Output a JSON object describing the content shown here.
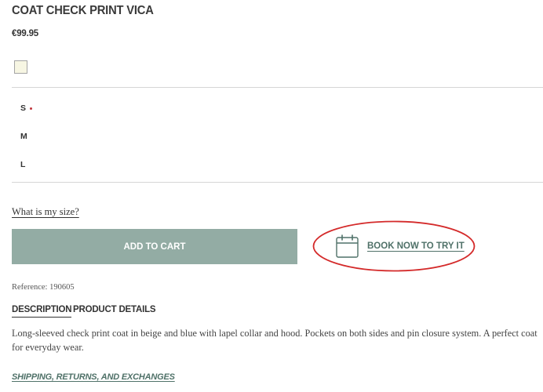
{
  "product": {
    "title": "COAT CHECK PRINT VICA",
    "price": "€99.95",
    "reference": "Reference: 190605"
  },
  "colors": {
    "swatch": "#f7f6e3",
    "accent": "#93aca4",
    "link": "#4f7168",
    "highlight": "#d42a2a",
    "selected_dot": "#c0343c"
  },
  "sizes": [
    {
      "label": "S",
      "selected": true
    },
    {
      "label": "M",
      "selected": false
    },
    {
      "label": "L",
      "selected": false
    }
  ],
  "size_guide_link": "What is my size?",
  "actions": {
    "add_to_cart": "ADD TO CART",
    "book_try": "BOOK NOW TO TRY IT",
    "book_icon": "calendar-icon"
  },
  "tabs": [
    {
      "label": "DESCRIPTION",
      "active": true
    },
    {
      "label": "PRODUCT DETAILS",
      "active": false
    }
  ],
  "description": "Long-sleeved check print coat in beige and blue with lapel collar and hood. Pockets on both sides and pin closure system. A perfect coat for everyday wear.",
  "shipping_link": "SHIPPING, RETURNS, AND EXCHANGES"
}
